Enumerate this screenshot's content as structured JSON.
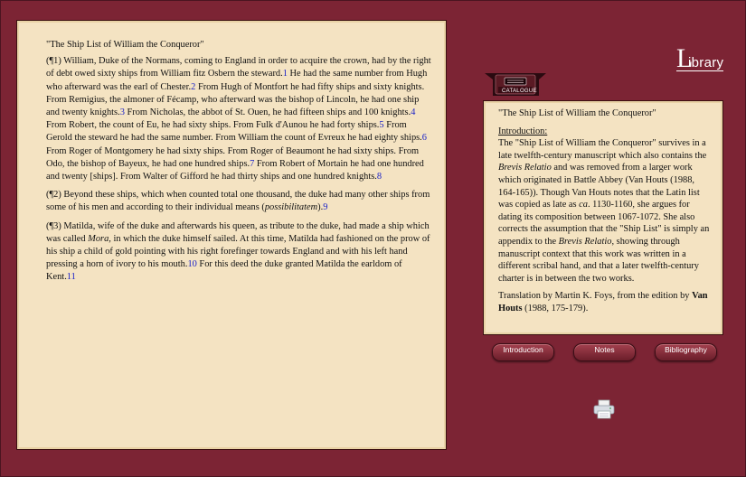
{
  "library_logo": {
    "big_letter": "L",
    "rest": "ibrary"
  },
  "catalogue": {
    "label": "CATALOGUE"
  },
  "main": {
    "title": "\"The Ship List of William the Conqueror\"",
    "p1": {
      "s1": "(¶1) William, Duke of the Normans, coming to England in order to acquire the crown, had by the right of debt owed sixty ships from William fitz Osbern the steward.",
      "f1": "1",
      "s2": " He had the same number from Hugh who afterward was the earl of Chester.",
      "f2": "2",
      "s3": " From Hugh of Montfort he had fifty ships and sixty knights. From Remigius, the almoner of Fécamp, who afterward was the bishop of Lincoln, he had one ship and twenty knights.",
      "f3": "3",
      "s4": " From Nicholas, the abbot of St. Ouen, he had fifteen ships and 100 knights.",
      "f4": "4",
      "s5": " From Robert, the count of Eu, he had sixty ships. From Fulk d'Aunou he had forty ships.",
      "f5": "5",
      "s6": " From Gerold the steward he had the same number. From William the count of Evreux he had eighty ships.",
      "f6": "6",
      "s7": " From Roger of Montgomery he had sixty ships. From Roger of Beaumont he had sixty ships. From Odo, the bishop of Bayeux, he had one hundred ships.",
      "f7": "7",
      "s8": " From Robert of Mortain he had one hundred and twenty [ships]. From Walter of Gifford he had thirty ships and one hundred knights.",
      "f8": "8"
    },
    "p2": {
      "s1": "(¶2) Beyond these ships, which when counted total one thousand, the duke had many other ships from some of his men and according to their individual means (",
      "em": "possibilitatem",
      "s2": ").",
      "f9": "9"
    },
    "p3": {
      "s1": "(¶3) Matilda, wife of the duke and afterwards his queen, as tribute to the duke, had made a ship which was called ",
      "em": "Mora,",
      "s2": " in which the duke himself sailed. At this time, Matilda had fashioned on the prow of his ship a child of gold pointing with his right forefinger towards England and with his left hand pressing a horn of ivory to his mouth.",
      "f10": "10",
      "s3": " For this deed the duke granted Matilda the earldom of Kent.",
      "f11": "11"
    }
  },
  "side": {
    "title": "\"The Ship List of William the Conqueror\"",
    "intro_heading": "Introduction:",
    "t1": "The \"Ship List of William the Conqueror\" survives in a late twelfth-century manuscript which also contains the ",
    "em1": "Brevis Relatio",
    "t2": " and was removed from a larger work which originated in Battle Abbey (Van Houts (1988, 164-165)). Though Van Houts notes that the Latin list was copied as late as ",
    "em2": "ca",
    "t3": ". 1130-1160, she argues for dating its composition between 1067-1072. She also corrects the assumption that the \"Ship List\" is simply an appendix to the ",
    "em3": "Brevis Relatio",
    "t4": ", showing through manuscript context that this work was written in a different scribal hand, and that a later twelfth-century charter is in between the two works.",
    "credit": "Translation by Martin K. Foys, from the edition by ",
    "credit_bold": "Van Houts",
    "credit_end": " (1988, 175-179)."
  },
  "buttons": {
    "introduction": "Introduction",
    "notes": "Notes",
    "bibliography": "Bibliography"
  },
  "icons": {
    "print": "printer-icon",
    "catalogue": "catalogue-drawer-icon"
  },
  "colors": {
    "background": "#7c2434",
    "panel": "#f4e3c2",
    "footnote_link": "#1a22c8"
  }
}
